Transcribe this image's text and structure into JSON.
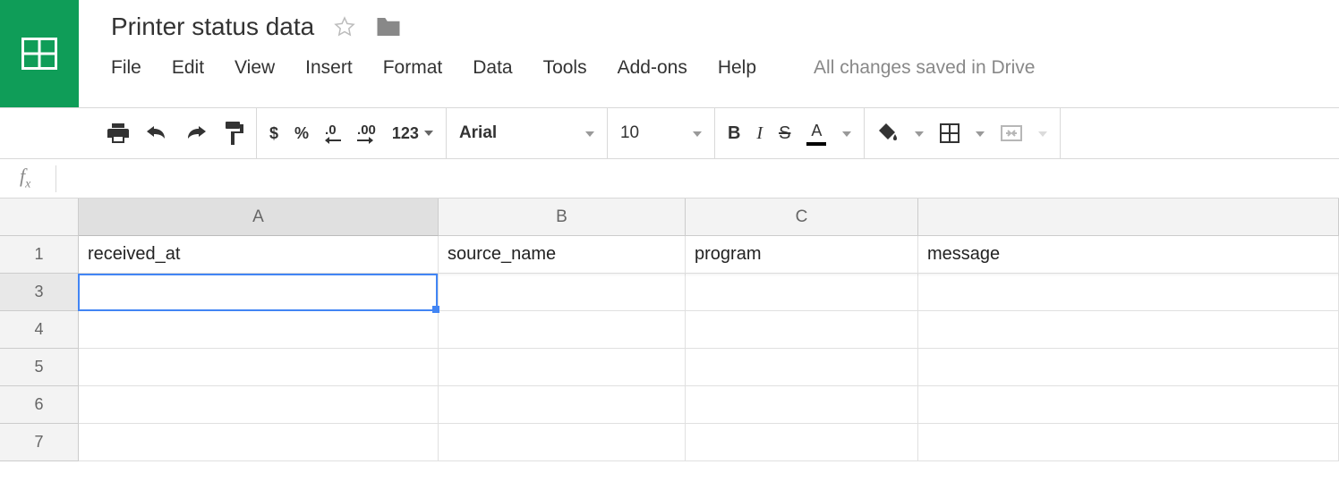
{
  "doc": {
    "title": "Printer status data"
  },
  "menubar": {
    "items": [
      "File",
      "Edit",
      "View",
      "Insert",
      "Format",
      "Data",
      "Tools",
      "Add-ons",
      "Help"
    ],
    "status": "All changes saved in Drive"
  },
  "toolbar": {
    "currency": "$",
    "percent": "%",
    "dec_less": ".0",
    "dec_more": ".00",
    "num_fmt": "123",
    "font_name": "Arial",
    "font_size": "10",
    "bold": "B",
    "italic": "I",
    "strike": "S",
    "textcolor": "A"
  },
  "formula_bar": {
    "fx": "fx",
    "value": ""
  },
  "grid": {
    "columns": [
      "A",
      "B",
      "C",
      ""
    ],
    "row_numbers": [
      "1",
      "3",
      "4",
      "5",
      "6",
      "7"
    ],
    "row1": {
      "A": "received_at",
      "B": "source_name",
      "C": "program",
      "D": "message"
    },
    "selected_cell": "A3"
  }
}
